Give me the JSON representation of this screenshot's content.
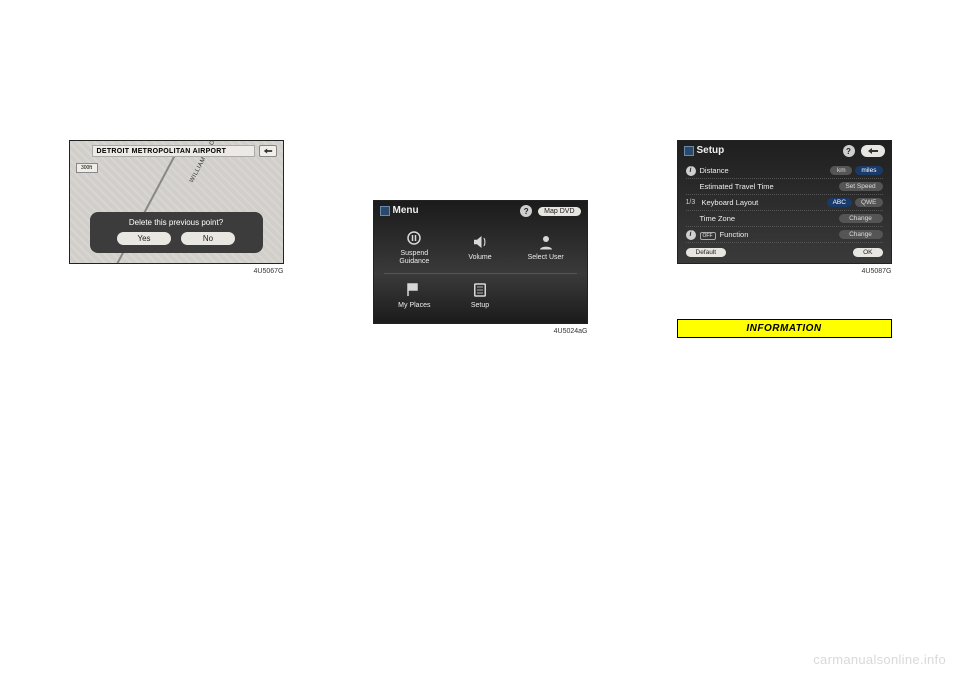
{
  "column1": {
    "nav_title": "DETROIT METROPOLITAN AIRPORT",
    "scale": "300ft",
    "road_label": "WILLIAM C ROGELL",
    "dialog_text": "Delete this previous point?",
    "yes": "Yes",
    "no": "No",
    "img_code": "4U5067G"
  },
  "column2": {
    "menu_title": "Menu",
    "help": "?",
    "map_dvd": "Map DVD",
    "items": {
      "suspend": "Suspend\nGuidance",
      "volume": "Volume",
      "select_user": "Select User",
      "my_places": "My Places",
      "setup": "Setup"
    },
    "img_code": "4U5024aG"
  },
  "column3": {
    "setup_title": "Setup",
    "help": "?",
    "rows": {
      "distance": "Distance",
      "km": "km",
      "miles": "miles",
      "est_time": "Estimated Travel Time",
      "set_speed": "Set Speed",
      "page": "1/3",
      "keyboard": "Keyboard Layout",
      "abc": "ABC",
      "qwe": "QWE",
      "timezone": "Time Zone",
      "change": "Change",
      "off_func": "Function",
      "off_icon": "OFF"
    },
    "default": "Default",
    "ok": "OK",
    "img_code": "4U5087G",
    "info_label": "INFORMATION"
  },
  "watermark": "carmanualsonline.info"
}
